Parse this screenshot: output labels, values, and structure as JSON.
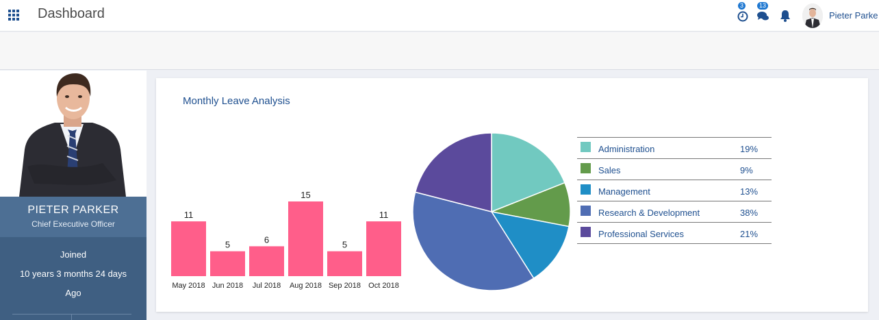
{
  "header": {
    "title": "Dashboard",
    "clock_badge": "3",
    "messages_badge": "13",
    "user_name": "Pieter Parke"
  },
  "profile": {
    "name": "PIETER PARKER",
    "role": "Chief Executive Officer",
    "joined_label": "Joined",
    "tenure": "10 years 3 months 24 days",
    "ago": "Ago"
  },
  "panel": {
    "title": "Monthly Leave Analysis"
  },
  "chart_data": [
    {
      "type": "bar",
      "categories": [
        "May 2018",
        "Jun 2018",
        "Jul 2018",
        "Aug 2018",
        "Sep 2018",
        "Oct 2018"
      ],
      "values": [
        11,
        5,
        6,
        15,
        5,
        11
      ],
      "color": "#ff5e8a",
      "data_labels": true
    },
    {
      "type": "pie",
      "slices": [
        {
          "label": "Administration",
          "value": 19,
          "display": "19%",
          "color": "#71c9c0"
        },
        {
          "label": "Sales",
          "value": 9,
          "display": "9%",
          "color": "#639b4b"
        },
        {
          "label": "Management",
          "value": 13,
          "display": "13%",
          "color": "#1f8ec6"
        },
        {
          "label": "Research & Development",
          "value": 38,
          "display": "38%",
          "color": "#4f6db3"
        },
        {
          "label": "Professional Services",
          "value": 21,
          "display": "21%",
          "color": "#5b4a9c"
        }
      ]
    }
  ]
}
